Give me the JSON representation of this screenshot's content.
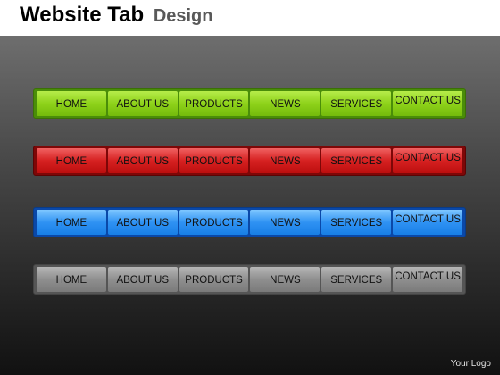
{
  "title": {
    "main": "Website Tab",
    "sub": "Design"
  },
  "tabs": [
    "HOME",
    "ABOUT US",
    "PRODUCTS",
    "NEWS",
    "SERVICES",
    "CONTACT US"
  ],
  "bars": [
    {
      "name": "green",
      "color": "#8ed21a"
    },
    {
      "name": "red",
      "color": "#d62121"
    },
    {
      "name": "blue",
      "color": "#2f92f3"
    },
    {
      "name": "gray",
      "color": "#8f8f8f"
    }
  ],
  "footer": {
    "logo_text": "Your Logo"
  }
}
